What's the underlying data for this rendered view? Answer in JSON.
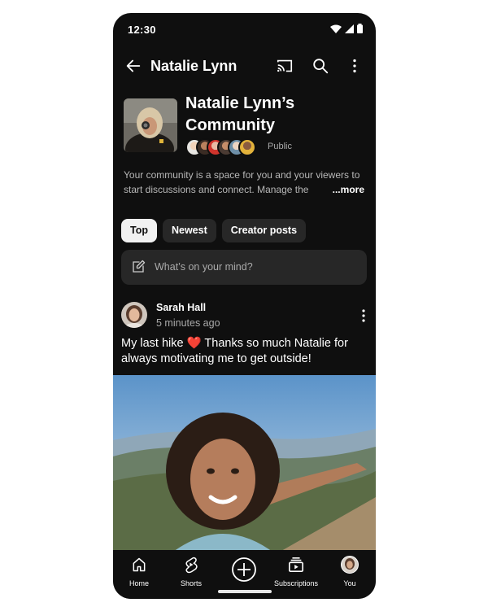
{
  "status_bar": {
    "time": "12:30"
  },
  "app_bar": {
    "title": "Natalie Lynn",
    "icons": [
      "back-arrow-icon",
      "cast-icon",
      "search-icon",
      "more-vert-icon"
    ]
  },
  "community": {
    "title": "Natalie Lynn’s Community",
    "visibility": "Public",
    "description": "Your community is a space for you and your viewers to start discussions and connect. Manage the",
    "more_label": "...more"
  },
  "chips": [
    {
      "label": "Top",
      "active": true
    },
    {
      "label": "Newest",
      "active": false
    },
    {
      "label": "Creator posts",
      "active": false
    }
  ],
  "composer": {
    "placeholder": "What’s on your mind?"
  },
  "post": {
    "author": "Sarah Hall",
    "time": "5 minutes ago",
    "text": "My last hike ❤️ Thanks so much Natalie for always motivating me to get outside!"
  },
  "bottom_nav": [
    {
      "label": "Home",
      "icon": "home-icon"
    },
    {
      "label": "Shorts",
      "icon": "shorts-icon"
    },
    {
      "label": "",
      "icon": "create-plus-icon"
    },
    {
      "label": "Subscriptions",
      "icon": "subscriptions-icon"
    },
    {
      "label": "You",
      "icon": "profile-avatar-icon"
    }
  ],
  "colors": {
    "background": "#0f0f0f",
    "chip_bg": "#272727",
    "chip_active_bg": "#f1f1f1",
    "secondary_text": "#aaaaaa"
  }
}
